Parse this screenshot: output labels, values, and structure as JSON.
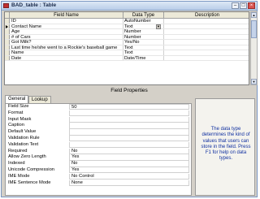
{
  "window": {
    "title": "BAD_table : Table"
  },
  "grid": {
    "headers": {
      "field_name": "Field Name",
      "data_type": "Data Type",
      "description": "Description"
    },
    "rows": [
      {
        "name": "ID",
        "type": "AutoNumber"
      },
      {
        "name": "Contact Name",
        "type": "Text"
      },
      {
        "name": "Age",
        "type": "Number"
      },
      {
        "name": "# of Cars",
        "type": "Number"
      },
      {
        "name": "Got Milk?",
        "type": "Yes/No"
      },
      {
        "name": "Last time he/she went to a Rockie's baseball game",
        "type": "Text"
      },
      {
        "name": "Name",
        "type": "Text"
      },
      {
        "name": "Date",
        "type": "Date/Time"
      }
    ]
  },
  "field_properties": {
    "label": "Field Properties",
    "tabs": [
      "General",
      "Lookup"
    ],
    "props": [
      {
        "label": "Field Size",
        "value": "50"
      },
      {
        "label": "Format",
        "value": ""
      },
      {
        "label": "Input Mask",
        "value": ""
      },
      {
        "label": "Caption",
        "value": ""
      },
      {
        "label": "Default Value",
        "value": ""
      },
      {
        "label": "Validation Rule",
        "value": ""
      },
      {
        "label": "Validation Text",
        "value": ""
      },
      {
        "label": "Required",
        "value": "No"
      },
      {
        "label": "Allow Zero Length",
        "value": "Yes"
      },
      {
        "label": "Indexed",
        "value": "No"
      },
      {
        "label": "Unicode Compression",
        "value": "Yes"
      },
      {
        "label": "IME Mode",
        "value": "No Control"
      },
      {
        "label": "IME Sentence Mode",
        "value": "None"
      }
    ],
    "help": "The data type determines the kind of values that users can store in the field. Press F1 for help on data types."
  }
}
